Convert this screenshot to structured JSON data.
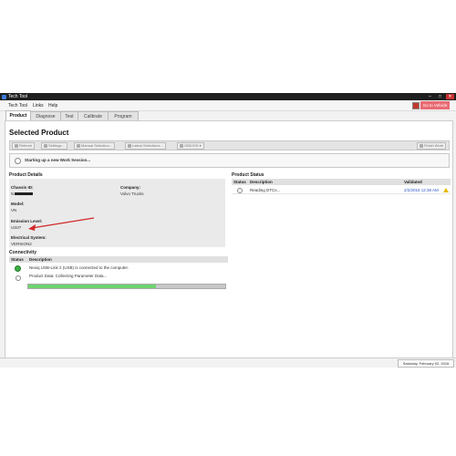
{
  "window": {
    "title": "Tech Tool"
  },
  "menu": [
    "Tech Tool",
    "Links",
    "Help"
  ],
  "header_button": "Go to Vehicle",
  "tabs": [
    "Product",
    "Diagnose",
    "Test",
    "Calibrate",
    "Program"
  ],
  "page_title": "Selected Product",
  "toolbar": {
    "refresh": "Refresh",
    "settings": "Settings...",
    "manual": "Manual Selection...",
    "latest": "Latest Selections...",
    "obd": "OBD/OS",
    "finish": "Finish Work"
  },
  "status_message": "Starting up a new Work Session...",
  "product_details": {
    "title": "Product Details",
    "chassis_label": "Chassis ID:",
    "chassis_value": "N",
    "company_label": "Company:",
    "company_value": "Volvo Trucks",
    "model_label": "Model:",
    "model_value": "VN",
    "emission_label": "Emission Level:",
    "emission_value": "US07",
    "electrical_label": "Electrical System:",
    "electrical_value": "VERSION2"
  },
  "product_status": {
    "title": "Product Status",
    "columns": [
      "Status",
      "Description",
      "Validated"
    ],
    "rows": [
      {
        "description": "Reading DTCs...",
        "validated": "2/2/2016 12:38 AM"
      }
    ]
  },
  "connectivity": {
    "title": "Connectivity",
    "columns": [
      "Status",
      "Description"
    ],
    "rows": [
      {
        "description": "Nexiq USB-Link 2 (USB) is connected to the computer."
      },
      {
        "description": "Product Data: Collecting Parameter Data..."
      }
    ],
    "progress_fraction": 0.65
  },
  "status_bar": {
    "date": "Saturday, February 02, 2016"
  },
  "colors": {
    "close": "#c83030",
    "go_button": "#e96a73",
    "progress": "#6fd46f",
    "connected": "#3cb043",
    "arrow": "#d22a2a"
  }
}
